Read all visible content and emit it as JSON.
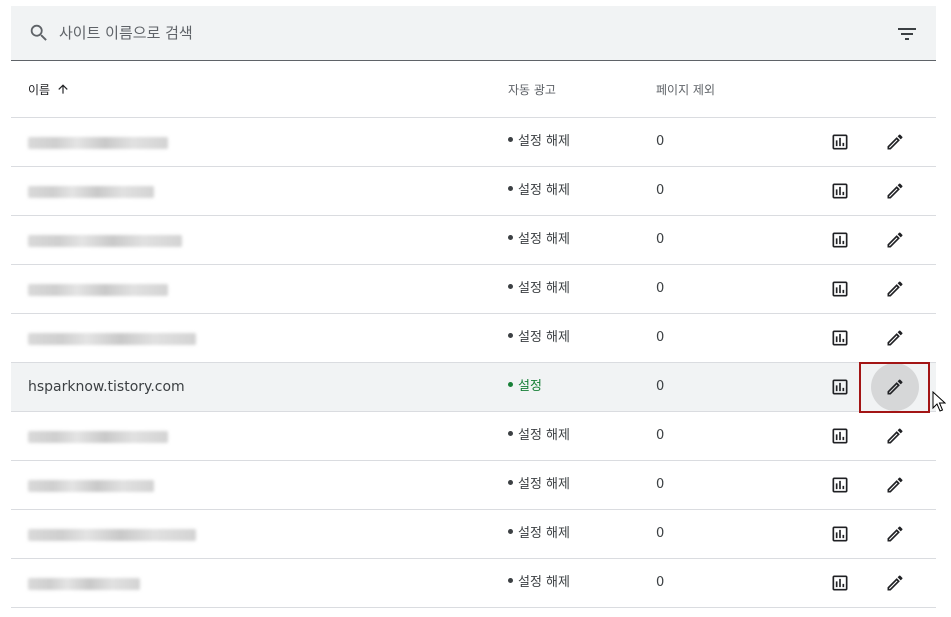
{
  "search": {
    "placeholder": "사이트 이름으로 검색"
  },
  "table": {
    "headers": {
      "name": "이름",
      "auto_ads": "자동 광고",
      "excluded_pages": "페이지 제외"
    },
    "rows": [
      {
        "name": "",
        "status": "설정 해제",
        "status_on": false,
        "excluded": "0"
      },
      {
        "name": "",
        "status": "설정 해제",
        "status_on": false,
        "excluded": "0"
      },
      {
        "name": "",
        "status": "설정 해제",
        "status_on": false,
        "excluded": "0"
      },
      {
        "name": "",
        "status": "설정 해제",
        "status_on": false,
        "excluded": "0"
      },
      {
        "name": "",
        "status": "설정 해제",
        "status_on": false,
        "excluded": "0"
      },
      {
        "name": "hsparknow.tistory.com",
        "status": "설정",
        "status_on": true,
        "excluded": "0"
      },
      {
        "name": "",
        "status": "설정 해제",
        "status_on": false,
        "excluded": "0"
      },
      {
        "name": "",
        "status": "설정 해제",
        "status_on": false,
        "excluded": "0"
      },
      {
        "name": "",
        "status": "설정 해제",
        "status_on": false,
        "excluded": "0"
      },
      {
        "name": "",
        "status": "설정 해제",
        "status_on": false,
        "excluded": "0"
      }
    ]
  },
  "icons": {
    "search": "search-icon",
    "filter": "filter-icon",
    "sort": "arrow-up-icon",
    "report": "bar-chart-icon",
    "edit": "pencil-icon"
  },
  "colors": {
    "status_on": "#188038",
    "highlight": "#a31515",
    "search_bg": "#f1f3f4"
  }
}
